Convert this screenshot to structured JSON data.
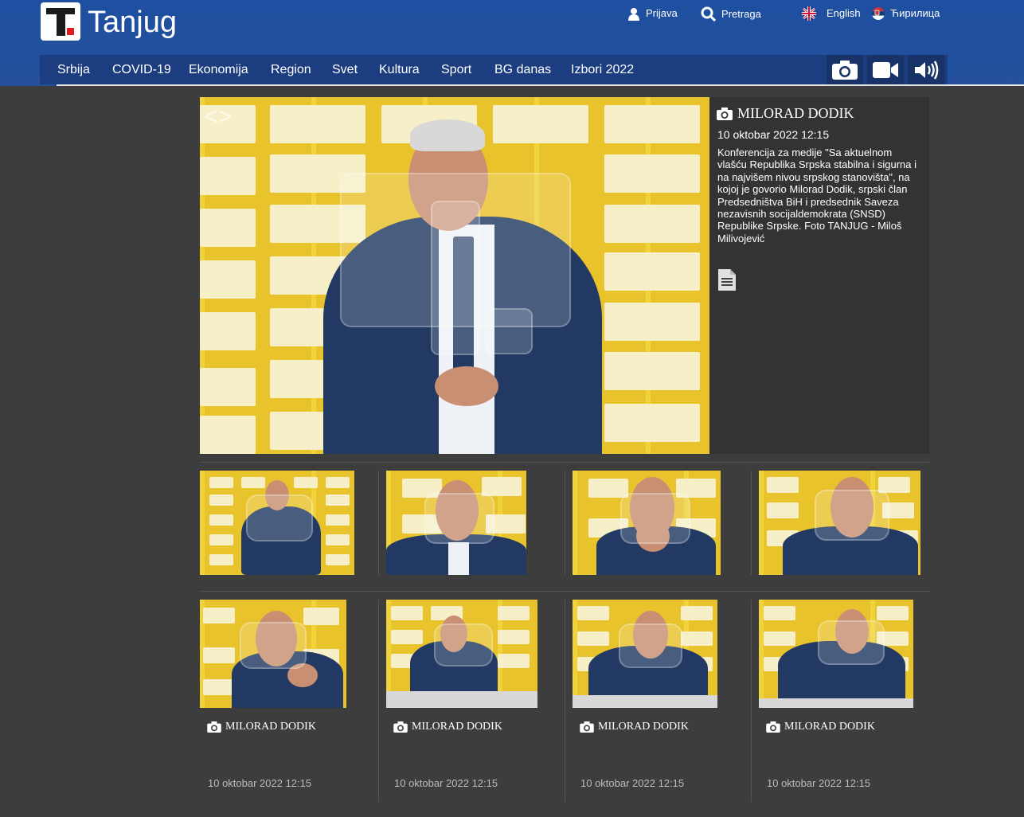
{
  "header": {
    "logo_text": "Tanjug",
    "login_label": "Prijava",
    "search_label": "Pretraga",
    "english_label": "English",
    "cyrillic_label": "Ћирилица"
  },
  "nav": {
    "items": [
      "Srbija",
      "COVID-19",
      "Ekonomija",
      "Region",
      "Svet",
      "Kultura",
      "Sport",
      "BG danas",
      "Izbori 2022"
    ]
  },
  "feature": {
    "title": "MILORAD DODIK",
    "date": "10 oktobar 2022 12:15",
    "description": "Konferencija za medije \"Sa aktuelnom vlašću Republika Srpska stabilna i sigurna i na najvišem nivou srpskog stanovišta\", na kojoj je govorio Milorad Dodik, srpski član Predsedništva BiH i predsednik Saveza nezavisnih socijaldemokrata (SNSD) Republike Srpske. Foto TANJUG - Miloš Milivojević"
  },
  "gallery": {
    "captions": [
      {
        "title": "MILORAD DODIK",
        "date": "10 oktobar 2022 12:15"
      },
      {
        "title": "MILORAD DODIK",
        "date": "10 oktobar 2022 12:15"
      },
      {
        "title": "MILORAD DODIK",
        "date": "10 oktobar 2022 12:15"
      },
      {
        "title": "MILORAD DODIK",
        "date": "10 oktobar 2022 12:15"
      }
    ]
  },
  "colors": {
    "header_blue": "#1e4fa0",
    "nav_blue": "#1c3e80",
    "page_bg": "#3d3d3d",
    "panel_bg": "#333333",
    "backdrop_yellow": "#f0d23a"
  },
  "icons": [
    "user-icon",
    "search-icon",
    "uk-flag-icon",
    "serbia-flag-icon",
    "camera-icon",
    "video-icon",
    "audio-icon",
    "document-icon"
  ]
}
